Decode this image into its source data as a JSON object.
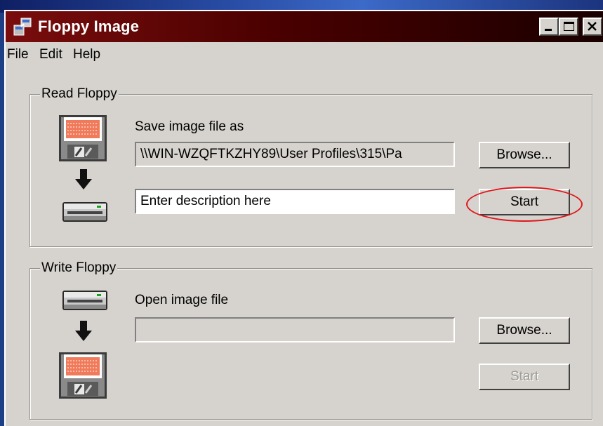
{
  "window": {
    "title": "Floppy Image",
    "controls": [
      "minimize",
      "maximize",
      "close"
    ]
  },
  "menu": {
    "items": [
      "File",
      "Edit",
      "Help"
    ]
  },
  "read_floppy": {
    "group_label": "Read Floppy",
    "save_label": "Save image file as",
    "save_path_value": "\\\\WIN-WZQFTKZHY89\\User Profiles\\315\\Pa",
    "description_value": "Enter description here",
    "browse_label": "Browse...",
    "start_label": "Start",
    "start_highlighted": true
  },
  "write_floppy": {
    "group_label": "Write Floppy",
    "open_label": "Open image file",
    "open_path_value": "",
    "browse_label": "Browse...",
    "start_label": "Start",
    "start_enabled": false
  },
  "icons": [
    "floppy-disk-icon",
    "arrow-down-icon",
    "floppy-drive-icon"
  ],
  "colors": {
    "titlebar_start": "#7a0d0d",
    "titlebar_end": "#1a0000",
    "window_face": "#d6d3ce",
    "highlight_ellipse": "#e0161c",
    "floppy_label": "#f07a5a"
  }
}
